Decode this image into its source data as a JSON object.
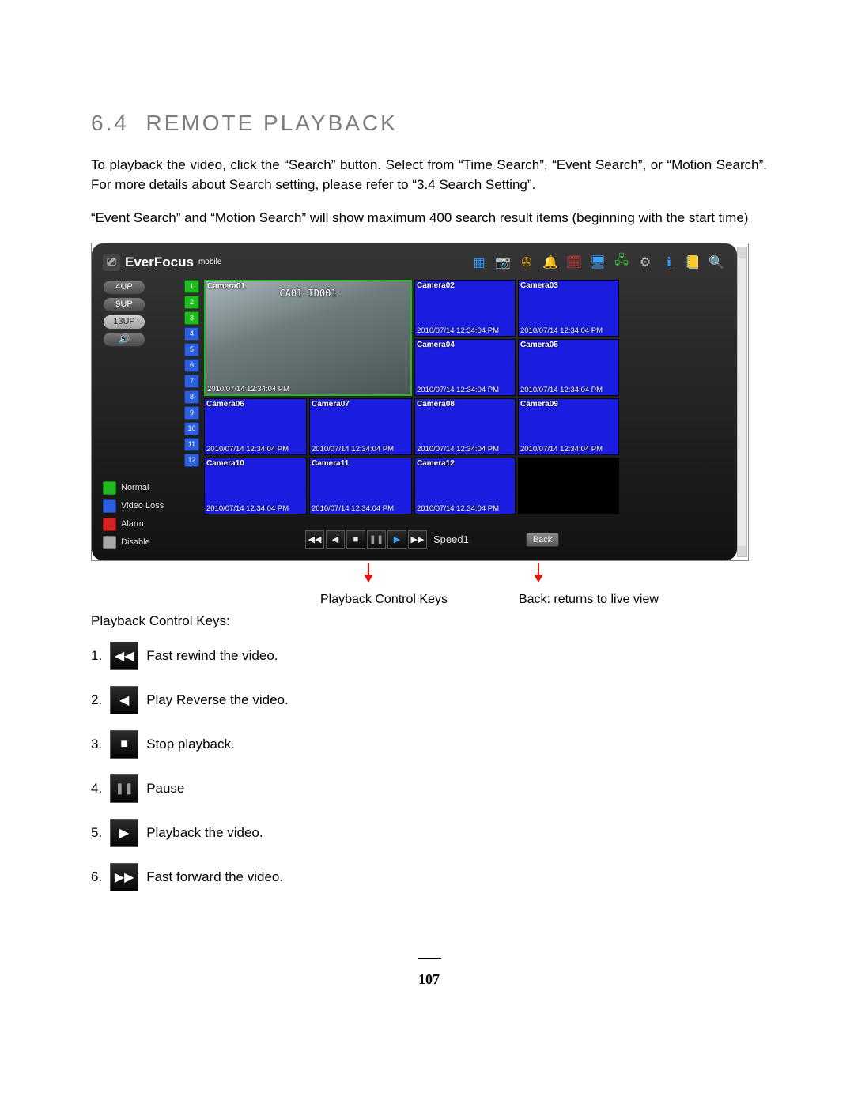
{
  "section": {
    "number": "6.4",
    "title": "REMOTE PLAYBACK"
  },
  "paragraphs": [
    "To playback the video, click the “Search” button. Select from “Time Search”, “Event Search”, or “Motion Search”.  For more details about Search setting, please refer to “3.4 Search Setting”.",
    "“Event Search” and “Motion Search” will show maximum 400 search result items (beginning with the start time)"
  ],
  "app": {
    "brand": "EverFocus",
    "brand_suffix": "mobile",
    "view_buttons": [
      "4UP",
      "9UP",
      "13UP"
    ],
    "active_view": "13UP",
    "channels": [
      1,
      2,
      3,
      4,
      5,
      6,
      7,
      8,
      9,
      10,
      11,
      12
    ],
    "green_channels": [
      1,
      2,
      3
    ],
    "legend": [
      {
        "color": "green",
        "label": "Normal"
      },
      {
        "color": "blue",
        "label": "Video Loss"
      },
      {
        "color": "red",
        "label": "Alarm"
      },
      {
        "color": "grey",
        "label": "Disable"
      }
    ],
    "big_cell": {
      "label": "Camera01",
      "overlay": "CA01 ID001",
      "timestamp": "2010/07/14  12:34:04 PM"
    },
    "cells": [
      {
        "label": "Camera02",
        "timestamp": "2010/07/14  12:34:04 PM"
      },
      {
        "label": "Camera03",
        "timestamp": "2010/07/14  12:34:04 PM"
      },
      {
        "label": "Camera04",
        "timestamp": "2010/07/14  12:34:04 PM"
      },
      {
        "label": "Camera05",
        "timestamp": "2010/07/14  12:34:04 PM"
      },
      {
        "label": "Camera06",
        "timestamp": "2010/07/14  12:34:04 PM"
      },
      {
        "label": "Camera07",
        "timestamp": "2010/07/14  12:34:04 PM"
      },
      {
        "label": "Camera08",
        "timestamp": "2010/07/14  12:34:04 PM"
      },
      {
        "label": "Camera09",
        "timestamp": "2010/07/14  12:34:04 PM"
      },
      {
        "label": "Camera10",
        "timestamp": "2010/07/14  12:34:04 PM"
      },
      {
        "label": "Camera11",
        "timestamp": "2010/07/14  12:34:04 PM"
      },
      {
        "label": "Camera12",
        "timestamp": "2010/07/14  12:34:04 PM"
      }
    ],
    "speed_label": "Speed1",
    "back_label": "Back"
  },
  "annotations": {
    "left": "Playback Control Keys",
    "right": "Back: returns to live view"
  },
  "keys_intro": "Playback Control Keys:",
  "keys": [
    {
      "n": "1.",
      "glyph": "◀◀",
      "desc": "Fast rewind the video."
    },
    {
      "n": "2.",
      "glyph": "◀",
      "desc": "Play Reverse the video."
    },
    {
      "n": "3.",
      "glyph": "■",
      "desc": "Stop playback."
    },
    {
      "n": "4.",
      "glyph": "❚❚",
      "grey": true,
      "desc": "Pause"
    },
    {
      "n": "5.",
      "glyph": "▶",
      "desc": "Playback the video."
    },
    {
      "n": "6.",
      "glyph": "▶▶",
      "desc": "Fast forward the video."
    }
  ],
  "page_number": "107"
}
